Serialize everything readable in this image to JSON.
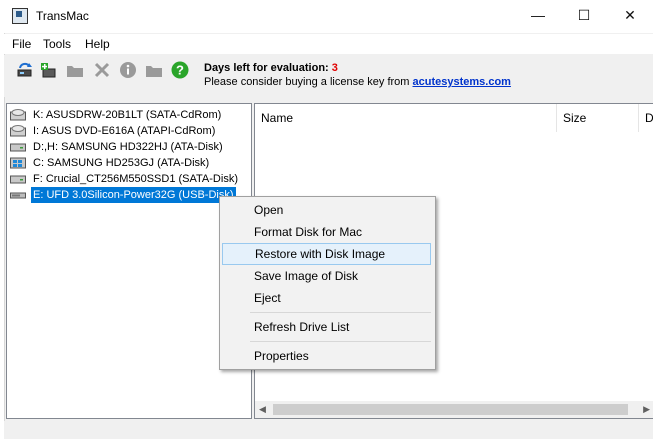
{
  "window": {
    "title": "TransMac",
    "minimize_glyph": "—",
    "maximize_glyph": "☐",
    "close_glyph": "✕"
  },
  "menu": {
    "items": [
      "File",
      "Tools",
      "Help"
    ]
  },
  "toolbar": {
    "icons": [
      "refresh-drive-icon",
      "add-disk-icon",
      "folder-icon",
      "delete-icon",
      "info-icon",
      "new-folder-icon",
      "help-icon"
    ],
    "eval_label": "Days left for evaluation: ",
    "eval_days": "3",
    "license_text": "Please consider buying a license key from ",
    "license_link": "acutesystems.com",
    "colors": {
      "days": "#e00000",
      "link": "#0033cc",
      "help_icon": "#2aa52a"
    }
  },
  "drives": [
    {
      "label": "K: ASUSDRW-20B1LT (SATA-CdRom)",
      "icon": "cdrom-drive-icon",
      "selected": false
    },
    {
      "label": "I: ASUS DVD-E616A (ATAPI-CdRom)",
      "icon": "cdrom-drive-icon",
      "selected": false
    },
    {
      "label": "D:,H: SAMSUNG HD322HJ (ATA-Disk)",
      "icon": "hard-disk-icon",
      "selected": false
    },
    {
      "label": "C: SAMSUNG HD253GJ (ATA-Disk)",
      "icon": "windows-disk-icon",
      "selected": false
    },
    {
      "label": "F: Crucial_CT256M550SSD1 (SATA-Disk)",
      "icon": "hard-disk-icon",
      "selected": false
    },
    {
      "label": "E: UFD 3.0Silicon-Power32G (USB-Disk)",
      "icon": "usb-disk-icon",
      "selected": true
    }
  ],
  "file_list": {
    "columns": [
      "Name",
      "Size",
      "D"
    ]
  },
  "context_menu": {
    "items": [
      {
        "label": "Open",
        "hover": false
      },
      {
        "label": "Format Disk for Mac",
        "hover": false
      },
      {
        "label": "Restore with Disk Image",
        "hover": true
      },
      {
        "label": "Save Image of Disk",
        "hover": false
      },
      {
        "label": "Eject",
        "hover": false
      },
      {
        "label": "Refresh Drive List",
        "hover": false
      },
      {
        "label": "Properties",
        "hover": false
      }
    ],
    "accent_selected": "#0078d7"
  }
}
